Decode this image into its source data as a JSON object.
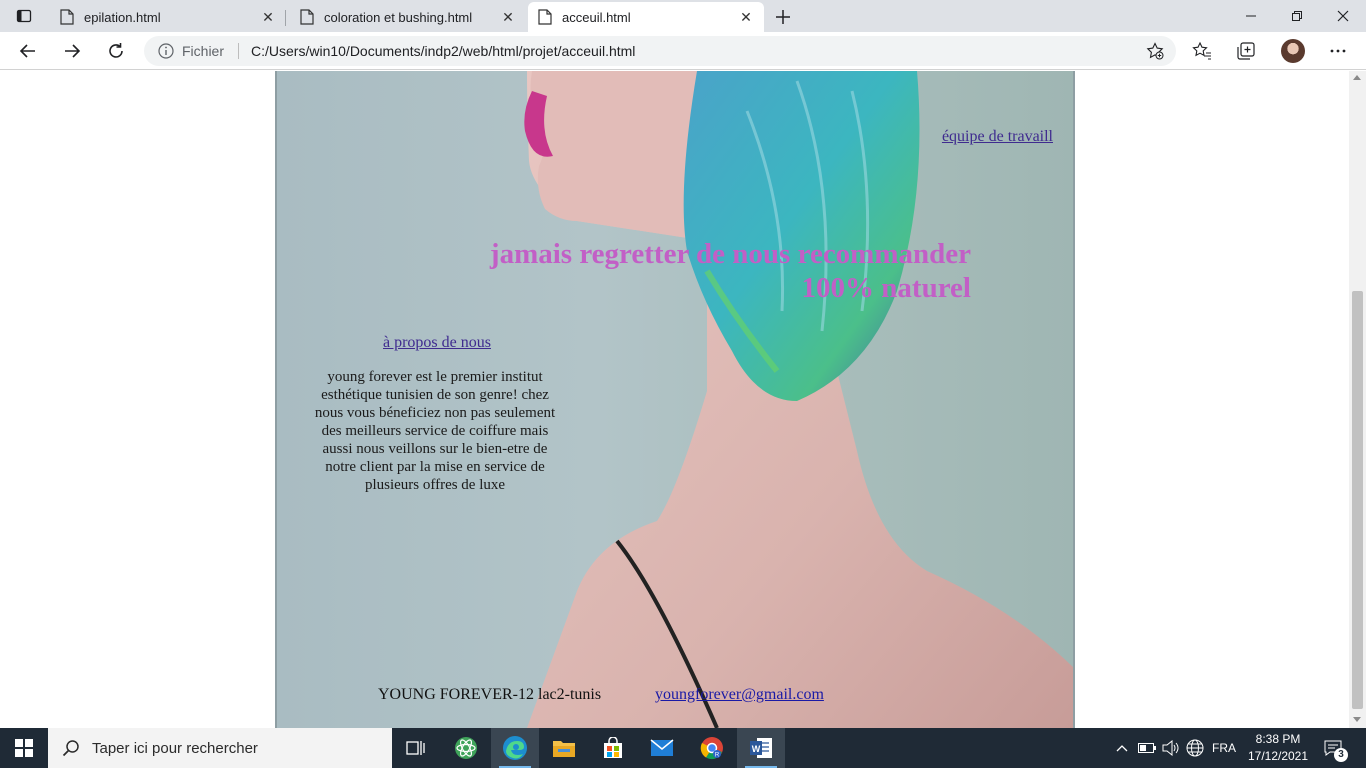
{
  "browser": {
    "tabs": [
      {
        "title": "epilation.html",
        "active": false
      },
      {
        "title": "coloration et bushing.html",
        "active": false
      },
      {
        "title": "acceuil.html",
        "active": true
      }
    ],
    "address": {
      "scheme_label": "Fichier",
      "url": "C:/Users/win10/Documents/indp2/web/html/projet/acceuil.html"
    }
  },
  "page": {
    "team_link": "équipe de travaill",
    "slogan_line1": "jamais regretter de nous recommander",
    "slogan_line2": "100% naturel",
    "about_link": "à propos de nous",
    "about_text": "young forever est le premier institut esthétique tunisien de son genre! chez nous vous béneficiez non pas seulement des meilleurs service de coiffure mais aussi nous veillons sur le bien-etre de notre client par la mise en service de plusieurs offres de luxe",
    "footer_address": "YOUNG FOREVER-12 lac2-tunis",
    "footer_email": "youngforever@gmail.com"
  },
  "taskbar": {
    "search_placeholder": "Taper ici pour rechercher",
    "language": "FRA",
    "time": "8:38 PM",
    "date": "17/12/2021",
    "notification_count": "3"
  },
  "colors": {
    "slogan": "#c25fc6",
    "link": "#3f2b8f",
    "taskbar": "#1f2a36"
  }
}
